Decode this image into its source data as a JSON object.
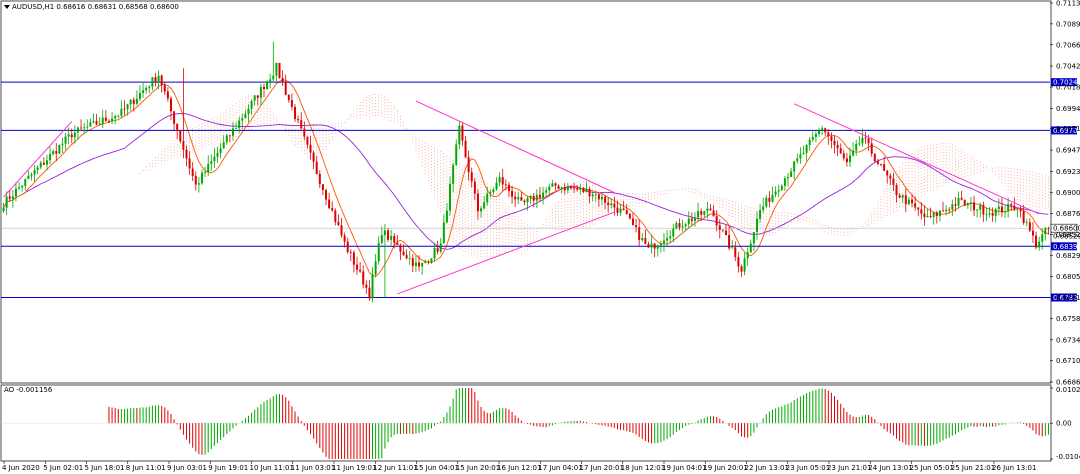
{
  "chart_data": [
    {
      "type": "candlestick",
      "title": "AUDUSD,H1  0.68616 0.68631 0.68568 0.68600",
      "symbol": "AUDUSD",
      "timeframe": "H1",
      "ohlc_header": {
        "open": 0.68616,
        "high": 0.68631,
        "low": 0.68568,
        "close": 0.686
      },
      "ylim": [
        0.66869,
        0.71134
      ],
      "y_ticks": [
        "0.71134",
        "0.70899",
        "0.70664",
        "0.70424",
        "0.70189",
        "0.69949",
        "0.69719",
        "0.69479",
        "0.69239",
        "0.69004",
        "0.68764",
        "0.68529",
        "0.68294",
        "0.68054",
        "0.67819",
        "0.67584",
        "0.67344",
        "0.67109",
        "0.66869"
      ],
      "x_ticks": [
        "4 Jun 2020",
        "5 Jun 02:01",
        "5 Jun 18:01",
        "8 Jun 11:01",
        "9 Jun 03:01",
        "9 Jun 19:01",
        "10 Jun 11:01",
        "11 Jun 03:01",
        "11 Jun 19:01",
        "12 Jun 11:01",
        "15 Jun 04:01",
        "15 Jun 20:01",
        "16 Jun 12:01",
        "17 Jun 04:01",
        "17 Jun 20:01",
        "18 Jun 12:01",
        "19 Jun 04:01",
        "19 Jun 20:01",
        "22 Jun 13:01",
        "23 Jun 05:01",
        "23 Jun 21:01",
        "24 Jun 13:01",
        "25 Jun 05:01",
        "25 Jun 21:01",
        "26 Jun 13:01"
      ],
      "current_price": "0.68600",
      "horizontal_levels": [
        {
          "value": 0.70243,
          "label": "0.70243"
        },
        {
          "value": 0.697,
          "label": "0.69700"
        },
        {
          "value": 0.68396,
          "label": "0.68396"
        },
        {
          "value": 0.6782,
          "label": "0.67820"
        }
      ],
      "extra_price_label": "0.68529",
      "trendlines": [
        {
          "from": {
            "i": 0,
            "y": 0.6895
          },
          "to": {
            "i": 22,
            "y": 0.698
          }
        },
        {
          "from": {
            "i": 133,
            "y": 0.7003
          },
          "to": {
            "i": 197,
            "y": 0.69
          }
        },
        {
          "from": {
            "i": 127,
            "y": 0.6786
          },
          "to": {
            "i": 197,
            "y": 0.6878
          }
        },
        {
          "from": {
            "i": 255,
            "y": 0.7
          },
          "to": {
            "i": 334,
            "y": 0.6876
          }
        }
      ],
      "indicators": [
        "Ichimoku Kinko Hyo",
        "Moving Average (fast)",
        "Moving Average (slow)"
      ],
      "colors": {
        "bull": "#00aa00",
        "bear": "#dd0000",
        "level": "#0000c8",
        "trend": "#ff33cc",
        "ma_fast": "#ff5500",
        "ma_slow": "#9922dd",
        "cloud_a": "#ff9966",
        "cloud_b": "#cc9999",
        "cloud_c": "#ff9999"
      },
      "waypoints": [
        [
          0,
          0.6888
        ],
        [
          22,
          0.6966
        ],
        [
          38,
          0.699
        ],
        [
          50,
          0.7033
        ],
        [
          62,
          0.6908
        ],
        [
          72,
          0.696
        ],
        [
          88,
          0.7041
        ],
        [
          98,
          0.695
        ],
        [
          110,
          0.6843
        ],
        [
          118,
          0.6786
        ],
        [
          122,
          0.6857
        ],
        [
          134,
          0.6815
        ],
        [
          141,
          0.6841
        ],
        [
          147,
          0.6971
        ],
        [
          153,
          0.688
        ],
        [
          160,
          0.6915
        ],
        [
          167,
          0.6886
        ],
        [
          178,
          0.6908
        ],
        [
          190,
          0.69
        ],
        [
          200,
          0.6877
        ],
        [
          208,
          0.6836
        ],
        [
          218,
          0.6864
        ],
        [
          228,
          0.6881
        ],
        [
          238,
          0.6814
        ],
        [
          244,
          0.688
        ],
        [
          255,
          0.6931
        ],
        [
          264,
          0.6974
        ],
        [
          272,
          0.6932
        ],
        [
          277,
          0.6962
        ],
        [
          288,
          0.69
        ],
        [
          298,
          0.687
        ],
        [
          308,
          0.689
        ],
        [
          318,
          0.6878
        ],
        [
          327,
          0.6885
        ],
        [
          333,
          0.6842
        ],
        [
          337,
          0.686
        ]
      ]
    },
    {
      "type": "histogram",
      "title": "AO -0.001156",
      "indicator": "Awesome Oscillator",
      "value": -0.001156,
      "ylim": [
        -0.010443,
        0.010241
      ],
      "y_ticks": [
        "0.010241",
        "0.00",
        "-0.010443"
      ],
      "colors": {
        "up": "#00aa00",
        "down": "#dd0000"
      }
    }
  ]
}
